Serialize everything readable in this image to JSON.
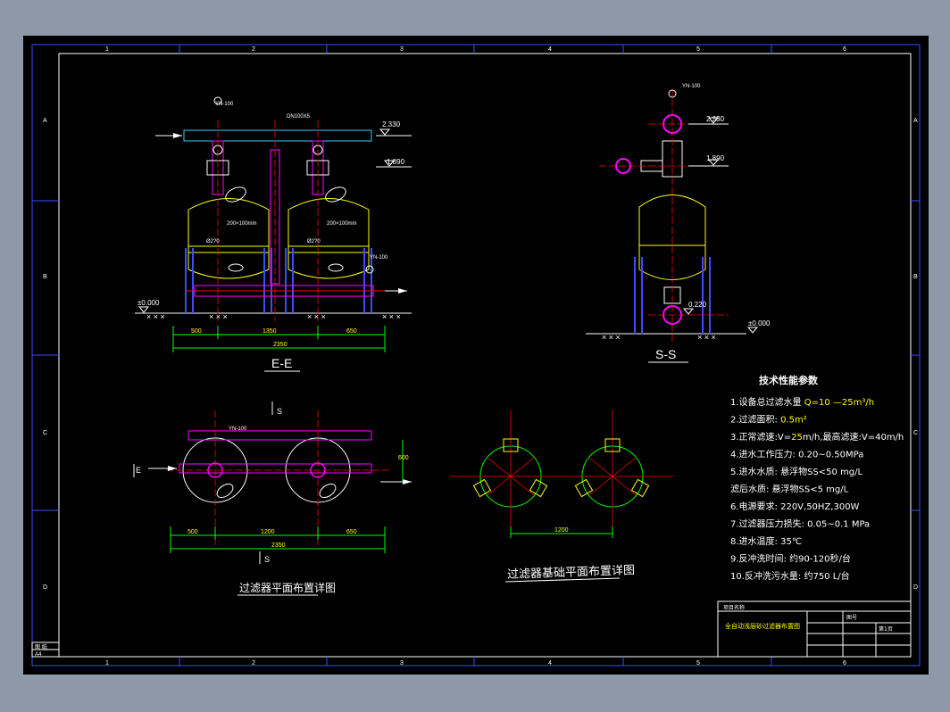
{
  "drawing": {
    "frame_col_numbers": [
      "1",
      "2",
      "3",
      "4",
      "5",
      "6"
    ],
    "frame_row_letters": [
      "A",
      "B",
      "C",
      "D"
    ],
    "colors": {
      "background": "#000000",
      "frame": "#3a4dff",
      "pipe": "#ff0000",
      "water_pipe": "#ff00ff",
      "tank": "#ffff00",
      "dim": "#00ff00",
      "center": "#ff0000",
      "text": "#ffffff",
      "highlight": "#ffff00"
    }
  },
  "view_ee": {
    "title": "E-E",
    "levels": [
      "2.330",
      "1.890",
      "±0.000",
      "0.5"
    ],
    "dims": [
      "500",
      "1350",
      "650",
      "2350"
    ],
    "tank_labels": [
      "Ø2?0",
      "200×100mm",
      "Ø2?0",
      "200×100mm"
    ],
    "gauge_label": "YN-100",
    "pipe_label": "DN100X5"
  },
  "view_ss": {
    "title": "S-S",
    "levels": [
      "2.330",
      "1.890",
      "0.220",
      "±0.000"
    ],
    "gauge_label": "YN-100"
  },
  "view_plan": {
    "title": "过滤器平面布置详图",
    "section_marks": [
      "S",
      "S",
      "E"
    ],
    "dims": [
      "500",
      "1200",
      "650",
      "2350"
    ],
    "gauge_label": "YN-100",
    "side_dim": "600"
  },
  "view_foundation": {
    "title": "过滤器基础平面布置详图",
    "dim": "1200"
  },
  "tech_params": {
    "heading": "技术性能参数",
    "items": [
      {
        "prefix": "1.设备总过滤水量 ",
        "value": "Q=10 —25m³/h",
        "suffix": ""
      },
      {
        "prefix": "2.过滤面积: ",
        "value": "0.5m²",
        "suffix": ""
      },
      {
        "prefix": "3.正常滤速:V=",
        "value": "25",
        "suffix": "m/h,最高滤速:V=40m/h"
      },
      {
        "prefix": "4.进水工作压力: 0.20~0.50MPa",
        "value": "",
        "suffix": ""
      },
      {
        "prefix": "5.进水水质: 悬浮物SS<50 mg/L",
        "value": "",
        "suffix": ""
      },
      {
        "prefix": "   滤后水质: 悬浮物SS<5 mg/L",
        "value": "",
        "suffix": ""
      },
      {
        "prefix": "6.电源要求: 220V,50HZ,300W",
        "value": "",
        "suffix": ""
      },
      {
        "prefix": "7.过滤器压力损失: 0.05~0.1 MPa",
        "value": "",
        "suffix": ""
      },
      {
        "prefix": "8.进水温度: 35℃",
        "value": "",
        "suffix": ""
      },
      {
        "prefix": "9.反冲洗时间: 约90-120秒/台",
        "value": "",
        "suffix": ""
      },
      {
        "prefix": "10.反冲洗污水量: 约750 L/台",
        "value": "",
        "suffix": ""
      }
    ]
  },
  "title_block": {
    "project_label": "项目名称",
    "drawing_name": "全自动浅层砂过滤器布置图",
    "drawing_no_label": "图号",
    "sheet_label": "第1页"
  },
  "corner_block": {
    "label": "图 纸",
    "size": "A4"
  }
}
